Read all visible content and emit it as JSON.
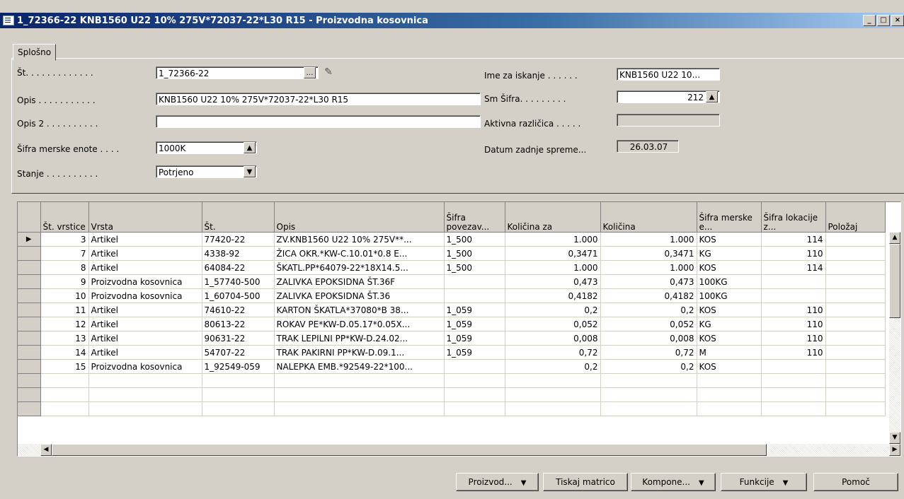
{
  "window": {
    "title": "1_72366-22 KNB1560 U22 10% 275V*72037-22*L30 R15 - Proizvodna kosovnica"
  },
  "tabs": [
    {
      "label": "Splošno"
    }
  ],
  "form": {
    "st_label": "Št. . . . . . . . . . . . .",
    "st_value": "1_72366-22",
    "opis_label": "Opis . . . . . . . . . . .",
    "opis_value": "KNB1560 U22 10% 275V*72037-22*L30 R15",
    "opis2_label": "Opis 2 . . . . . . . . . .",
    "opis2_value": "",
    "sifra_label": "Šifra merske enote . . . .",
    "sifra_value": "1000K",
    "stanje_label": "Stanje . . . . . . . . . .",
    "stanje_value": "Potrjeno",
    "ime_label": "Ime za iskanje . . . . . .",
    "ime_value": "KNB1560 U22 10...",
    "sm_label": "Sm Šifra. . . . . . . . .",
    "sm_value": "212",
    "aktivna_label": "Aktivna različica . . . . .",
    "aktivna_value": "",
    "datum_label": "Datum zadnje spreme...",
    "datum_value": "26.03.07"
  },
  "table": {
    "columns": [
      "Št. vrstice",
      "Vrsta",
      "Št.",
      "Opis",
      "Šifra povezav...",
      "Količina za",
      "Količina",
      "Šifra merske e...",
      "Šifra lokacije z...",
      "Položaj"
    ],
    "rows": [
      [
        "3",
        "Artikel",
        "77420-22",
        "ZV.KNB1560 U22 10% 275V**...",
        "1_500",
        "1.000",
        "1.000",
        "KOS",
        "114",
        ""
      ],
      [
        "7",
        "Artikel",
        "4338-92",
        "ŽICA OKR.*KW-C.10.01*0.8 E...",
        "1_500",
        "0,3471",
        "0,3471",
        "KG",
        "110",
        ""
      ],
      [
        "8",
        "Artikel",
        "64084-22",
        "ŠKATL.PP*64079-22*18X14.5...",
        "1_500",
        "1.000",
        "1.000",
        "KOS",
        "114",
        ""
      ],
      [
        "9",
        "Proizvodna kosovnica",
        "1_57740-500",
        "ZALIVKA EPOKSIDNA ŠT.36F",
        "",
        "0,473",
        "0,473",
        "100KG",
        "",
        ""
      ],
      [
        "10",
        "Proizvodna kosovnica",
        "1_60704-500",
        "ZALIVKA EPOKSIDNA ŠT.36",
        "",
        "0,4182",
        "0,4182",
        "100KG",
        "",
        ""
      ],
      [
        "11",
        "Artikel",
        "74610-22",
        "KARTON ŠKATLA*37080*B 38...",
        "1_059",
        "0,2",
        "0,2",
        "KOS",
        "110",
        ""
      ],
      [
        "12",
        "Artikel",
        "80613-22",
        "ROKAV PE*KW-D.05.17*0.05X...",
        "1_059",
        "0,052",
        "0,052",
        "KG",
        "110",
        ""
      ],
      [
        "13",
        "Artikel",
        "90631-22",
        "TRAK LEPILNI PP*KW-D.24.02...",
        "1_059",
        "0,008",
        "0,008",
        "KOS",
        "110",
        ""
      ],
      [
        "14",
        "Artikel",
        "54707-22",
        "TRAK PAKIRNI PP*KW-D.09.1...",
        "1_059",
        "0,72",
        "0,72",
        "M",
        "110",
        ""
      ],
      [
        "15",
        "Proizvodna kosovnica",
        "1_92549-059",
        "NALEPKA EMB.*92549-22*100...",
        "",
        "0,2",
        "0,2",
        "KOS",
        "",
        ""
      ]
    ]
  },
  "buttons": {
    "proizvod": "Proizvod...",
    "tiskaj": "Tiskaj matrico",
    "kompone": "Kompone...",
    "funkcije": "Funkcije",
    "pomoc": "Pomoč"
  }
}
